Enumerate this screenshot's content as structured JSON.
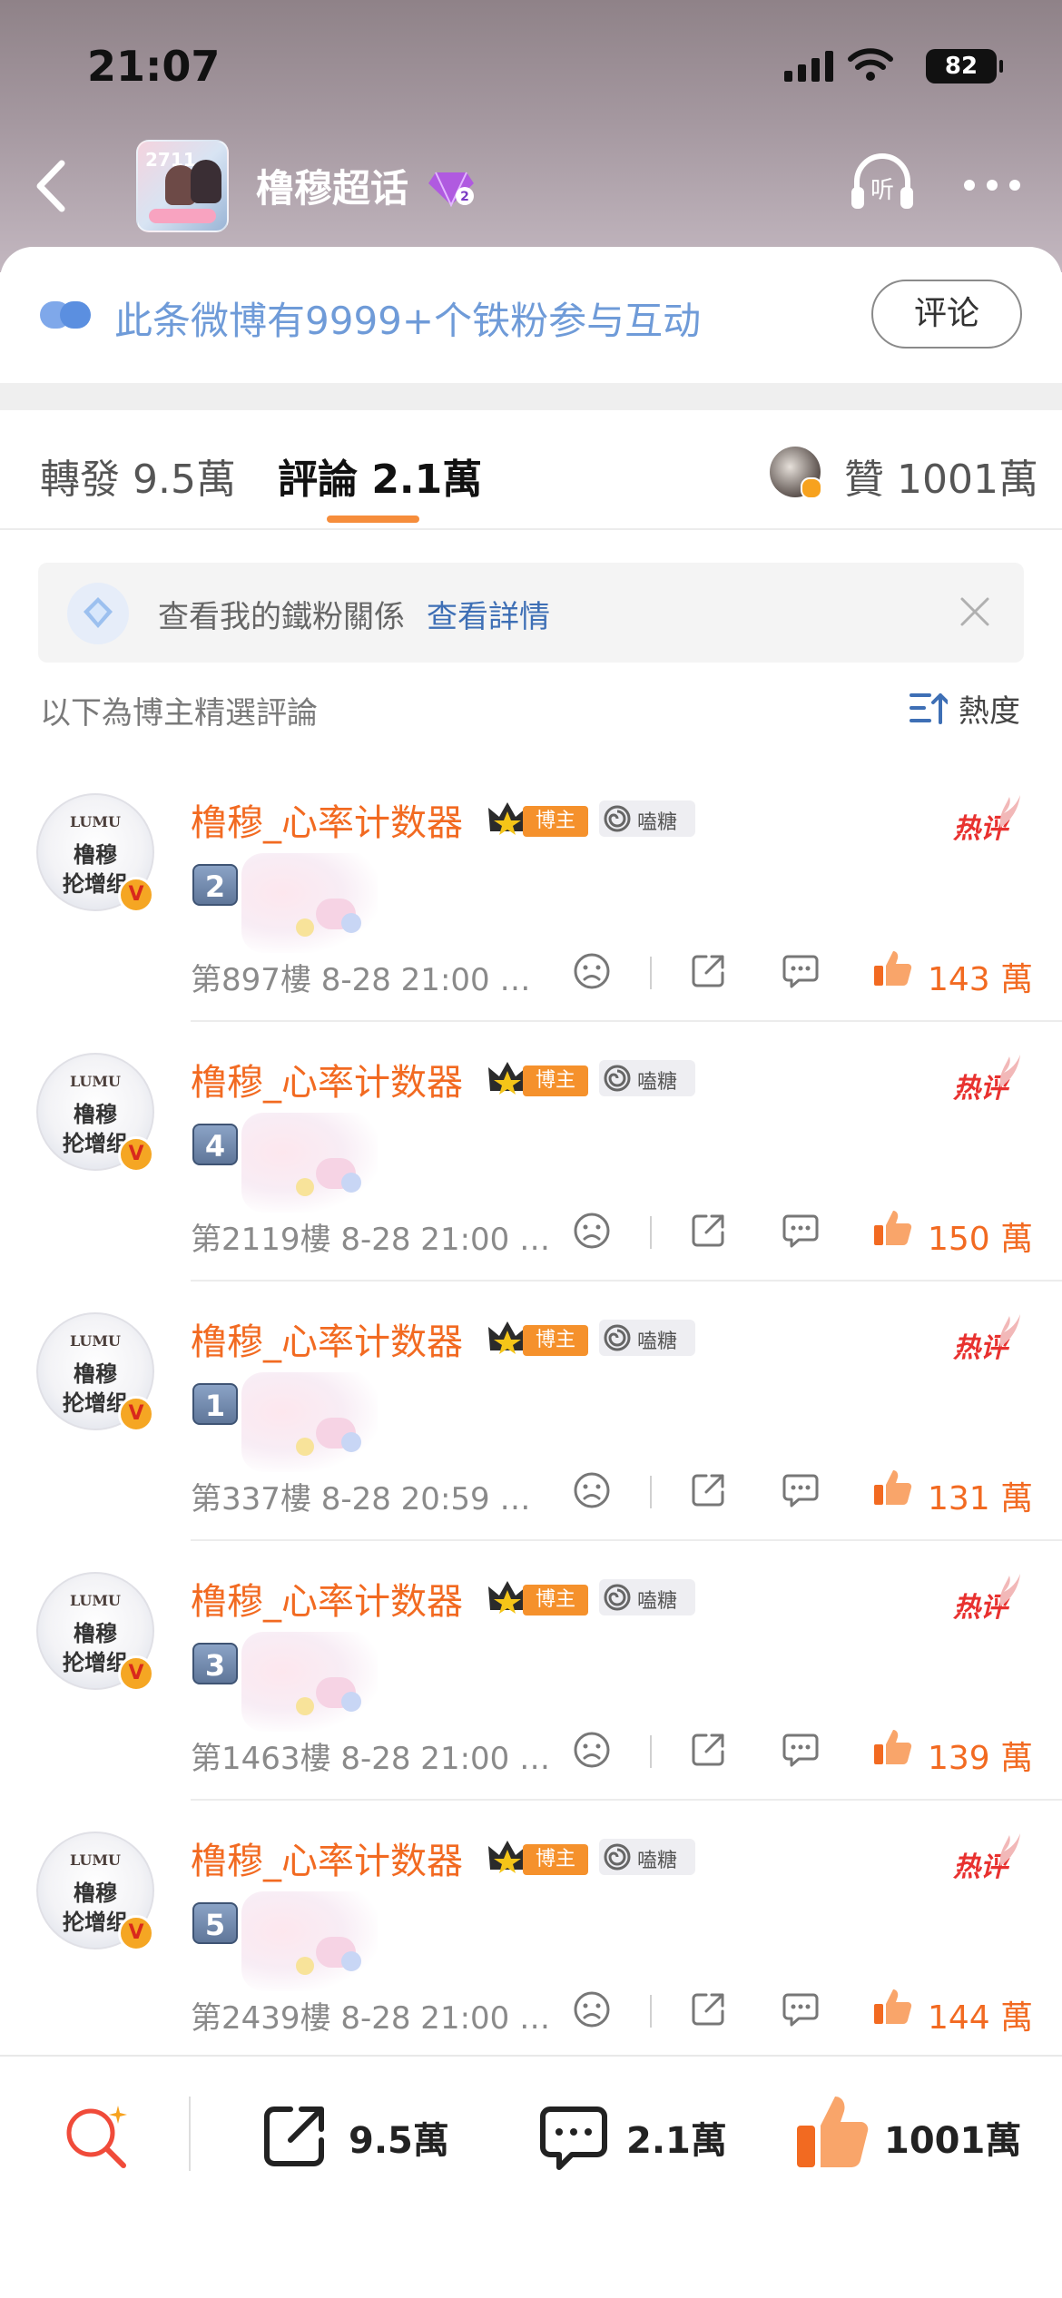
{
  "status_bar": {
    "time": "21:07",
    "battery": "82"
  },
  "nav": {
    "topic_title": "橹穆超话",
    "cover_text": "2711"
  },
  "fan_card": {
    "text": "此条微博有9999+个铁粉参与互动",
    "button": "评论"
  },
  "tabs": {
    "repost": "轉發 9.5萬",
    "comment": "評論 2.1萬",
    "like": "贊 1001萬"
  },
  "relation": {
    "text": "查看我的鐵粉關係",
    "link": "查看詳情"
  },
  "section": {
    "label": "以下為博主精選評論",
    "sort_label": "熱度"
  },
  "comments": [
    {
      "name": "橹穆_心率计数器",
      "crown_label": "博主",
      "candy_label": "嗑糖",
      "hot": "热评",
      "number": "2",
      "floor": "第897樓 8-28 21:00 …",
      "likes": "143 萬",
      "avatar_top": "LUMU",
      "avatar_line1": "橹穆",
      "avatar_line2": "抡增组"
    },
    {
      "name": "橹穆_心率计数器",
      "crown_label": "博主",
      "candy_label": "嗑糖",
      "hot": "热评",
      "number": "4",
      "floor": "第2119樓 8-28 21:00 …",
      "likes": "150 萬",
      "avatar_top": "LUMU",
      "avatar_line1": "橹穆",
      "avatar_line2": "抡增组"
    },
    {
      "name": "橹穆_心率计数器",
      "crown_label": "博主",
      "candy_label": "嗑糖",
      "hot": "热评",
      "number": "1",
      "floor": "第337樓 8-28 20:59 …",
      "likes": "131 萬",
      "avatar_top": "LUMU",
      "avatar_line1": "橹穆",
      "avatar_line2": "抡增组"
    },
    {
      "name": "橹穆_心率计数器",
      "crown_label": "博主",
      "candy_label": "嗑糖",
      "hot": "热评",
      "number": "3",
      "floor": "第1463樓 8-28 21:00 …",
      "likes": "139 萬",
      "avatar_top": "LUMU",
      "avatar_line1": "橹穆",
      "avatar_line2": "抡增组"
    },
    {
      "name": "橹穆_心率计数器",
      "crown_label": "博主",
      "candy_label": "嗑糖",
      "hot": "热评",
      "number": "5",
      "floor": "第2439樓 8-28 21:00 …",
      "likes": "144 萬",
      "avatar_top": "LUMU",
      "avatar_line1": "橹穆",
      "avatar_line2": "抡增组"
    }
  ],
  "bottom_bar": {
    "share_count": "9.5萬",
    "comment_count": "2.1萬",
    "like_count": "1001萬"
  },
  "icons": {
    "back": "chevron-left-icon",
    "listen": "headphones-icon",
    "more": "more-dots-icon",
    "fan": "iron-fan-icon",
    "relation": "diamond-icon",
    "close": "close-icon",
    "sort": "sort-icon",
    "dislike": "frown-icon",
    "share": "share-icon",
    "comment": "comment-icon",
    "like": "thumbs-up-icon",
    "search": "search-icon",
    "hot": "flame-icon",
    "crown": "crown-icon",
    "candy": "lollipop-icon"
  },
  "colors": {
    "accent": "#f26a21",
    "link": "#3e6fb5",
    "fan_text": "#6f9bd8",
    "hot": "#e8312f"
  }
}
